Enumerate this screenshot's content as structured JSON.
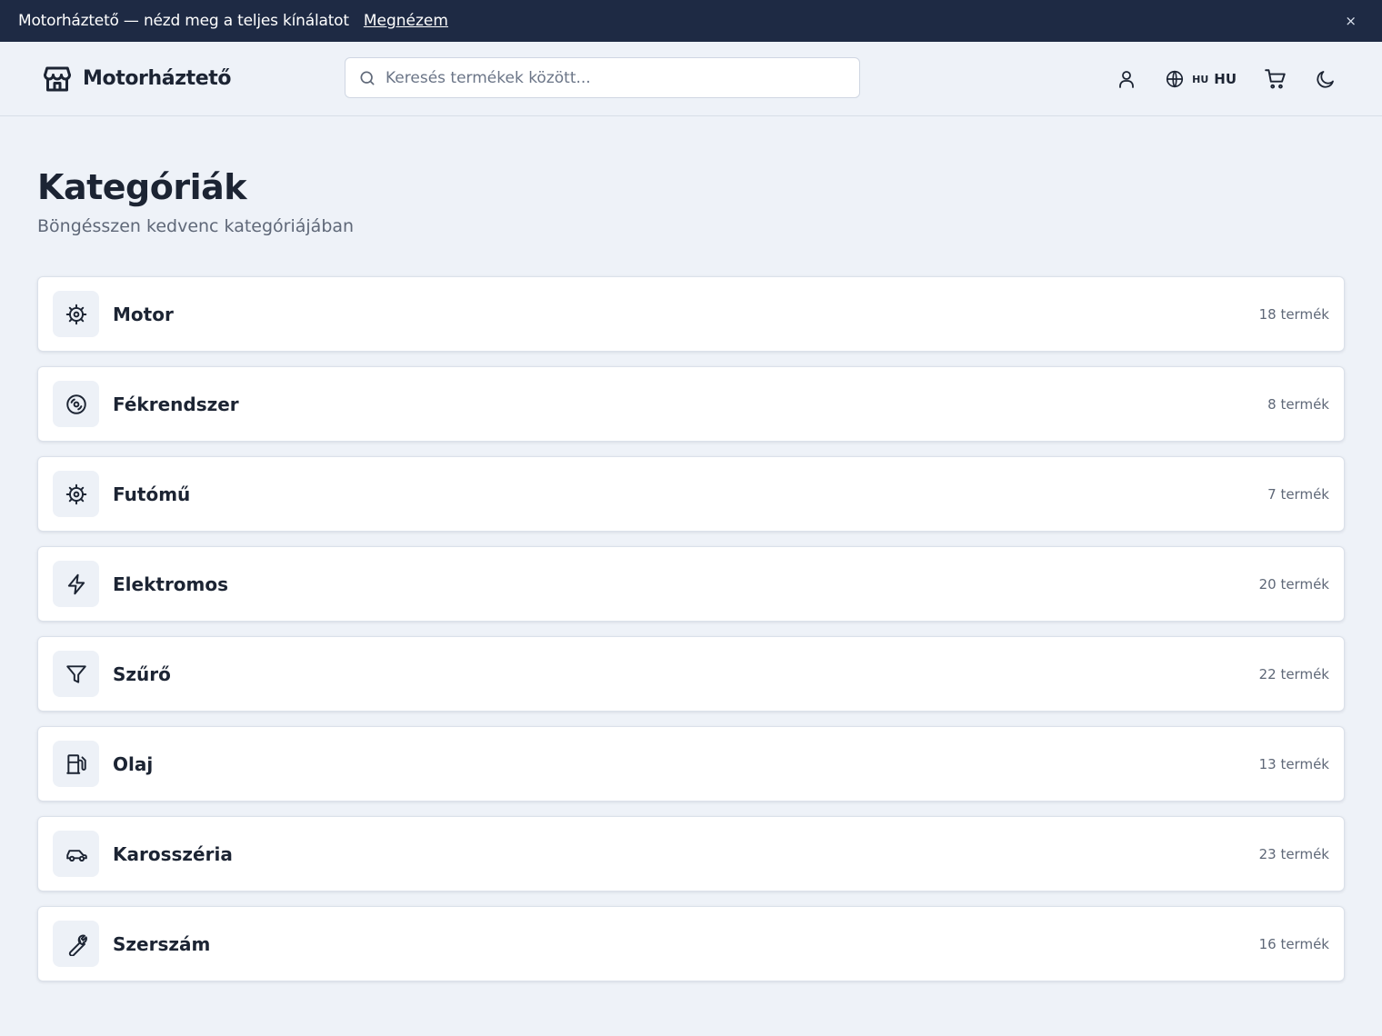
{
  "announcement": {
    "message": "Motorháztető — nézd meg a teljes kínálatot",
    "link_label": "Megnézem",
    "close_label": "×"
  },
  "header": {
    "brand": "Motorháztető",
    "search_placeholder": "Keresés termékek között...",
    "language_code_small": "HU",
    "language_code": "HU"
  },
  "page": {
    "title": "Kategóriák",
    "subtitle": "Böngésszen kedvenc kategóriájában"
  },
  "categories": [
    {
      "name": "Motor",
      "count": "18 termék",
      "icon": "gear-icon"
    },
    {
      "name": "Fékrendszer",
      "count": "8 termék",
      "icon": "disc-icon"
    },
    {
      "name": "Futómű",
      "count": "7 termék",
      "icon": "gear-icon"
    },
    {
      "name": "Elektromos",
      "count": "20 termék",
      "icon": "lightning-icon"
    },
    {
      "name": "Szűrő",
      "count": "22 termék",
      "icon": "filter-icon"
    },
    {
      "name": "Olaj",
      "count": "13 termék",
      "icon": "fuel-icon"
    },
    {
      "name": "Karosszéria",
      "count": "23 termék",
      "icon": "car-icon"
    },
    {
      "name": "Szerszám",
      "count": "16 termék",
      "icon": "wrench-icon"
    }
  ],
  "colors": {
    "announcement_bg": "#1e2a44",
    "page_bg": "#eef2f8",
    "text": "#1c2433",
    "muted": "#5f6878"
  }
}
